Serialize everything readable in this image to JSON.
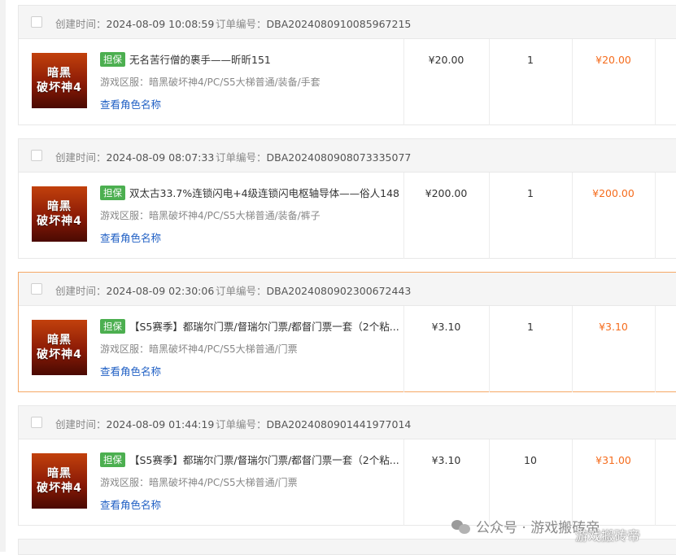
{
  "header_labels": {
    "created": "创建时间：",
    "order_no": "订单编号："
  },
  "orders": [
    {
      "created_time": "2024-08-09 10:08:59",
      "order_no": "DBA2024080910085967215",
      "game_icon_lines": [
        "暗黑",
        "破坏神4"
      ],
      "badge": "担保",
      "title": "无名苦行僧的裹手——昕昕151",
      "region": "游戏区服：暗黑破坏神4/PC/S5大梯普通/装备/手套",
      "view_role": "查看角色名称",
      "price": "¥20.00",
      "qty": "1",
      "total": "¥20.00"
    },
    {
      "created_time": "2024-08-09 08:07:33",
      "order_no": "DBA2024080908073335077",
      "game_icon_lines": [
        "暗黑",
        "破坏神4"
      ],
      "badge": "担保",
      "title": "双太古33.7%连锁闪电+4级连锁闪电枢轴导体——俗人148",
      "region": "游戏区服：暗黑破坏神4/PC/S5大梯普通/装备/裤子",
      "view_role": "查看角色名称",
      "price": "¥200.00",
      "qty": "1",
      "total": "¥200.00"
    },
    {
      "created_time": "2024-08-09 02:30:06",
      "order_no": "DBA2024080902300672443",
      "game_icon_lines": [
        "暗黑",
        "破坏神4"
      ],
      "badge": "担保",
      "title": "【S5赛季】都瑞尔门票/督瑞尔门票/都督门票一套（2个粘...",
      "region": "游戏区服：暗黑破坏神4/PC/S5大梯普通/门票",
      "view_role": "查看角色名称",
      "price": "¥3.10",
      "qty": "1",
      "total": "¥3.10"
    },
    {
      "created_time": "2024-08-09 01:44:19",
      "order_no": "DBA2024080901441977014",
      "game_icon_lines": [
        "暗黑",
        "破坏神4"
      ],
      "badge": "担保",
      "title": "【S5赛季】都瑞尔门票/督瑞尔门票/都督门票一套（2个粘...",
      "region": "游戏区服：暗黑破坏神4/PC/S5大梯普通/门票",
      "view_role": "查看角色名称",
      "price": "¥3.10",
      "qty": "10",
      "total": "¥31.00"
    }
  ],
  "watermark": {
    "icon": "wechat-icon",
    "text": "公众号 · 游戏搬砖帝",
    "overlay": "游戏搬砖帝"
  },
  "colors": {
    "accent_orange": "#f56c1d",
    "badge_green": "#4caf50",
    "link_blue": "#1f5fc4",
    "highlight_border": "#f6a866"
  }
}
